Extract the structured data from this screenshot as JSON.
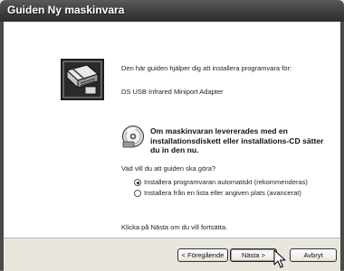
{
  "window": {
    "title": "Guiden Ny maskinvara"
  },
  "content": {
    "intro": "Den här guiden hjälper dig att installera programvara för:",
    "device": "DS USB Infrared Miniport Adapter",
    "cd_notice": {
      "line1": "Om maskinvaran levererades med en",
      "line2": "installationsdiskett eller installations-CD sätter",
      "line3": "du in den nu."
    },
    "question": "Vad vill du att guiden ska göra?",
    "options": [
      {
        "label": "Installera programvaran automatiskt (rekommenderas)",
        "selected": true
      },
      {
        "label": "Installera från en lista eller angiven plats (avancerat)",
        "selected": false
      }
    ],
    "continue_hint": "Klicka på Nästa om du vill fortsätta."
  },
  "buttons": {
    "back": "< Föregående",
    "next": "Nästa >",
    "cancel": "Avbryt"
  },
  "icons": {
    "hardware": "hardware-wizard-icon",
    "cd": "cd-icon",
    "cursor": "mouse-pointer-icon"
  }
}
